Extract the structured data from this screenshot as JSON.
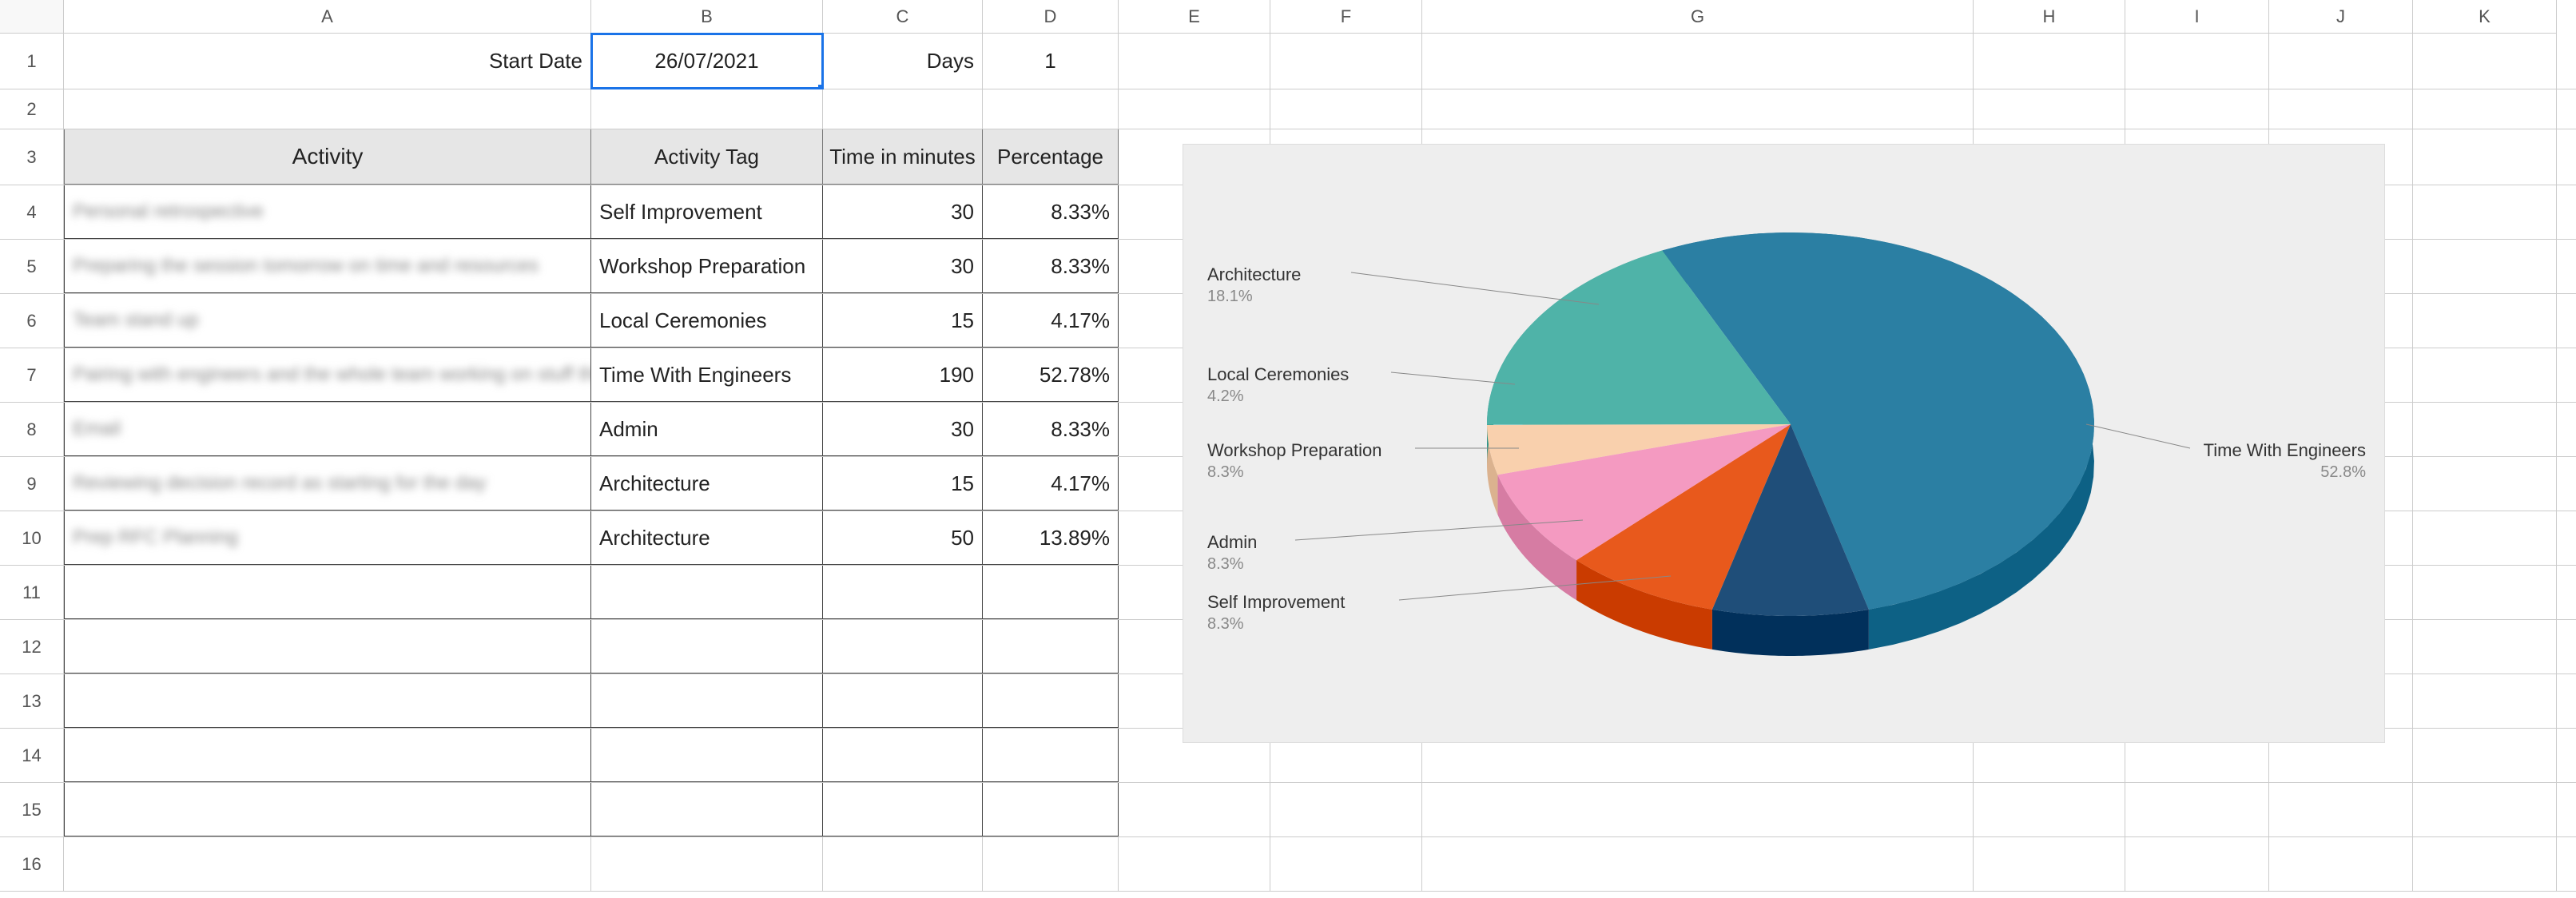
{
  "columns": [
    "A",
    "B",
    "C",
    "D",
    "E",
    "F",
    "G",
    "H",
    "I",
    "J",
    "K"
  ],
  "row_numbers": [
    1,
    2,
    3,
    4,
    5,
    6,
    7,
    8,
    9,
    10,
    11,
    12,
    13,
    14,
    15,
    16
  ],
  "meta_row": {
    "a_label": "Start Date",
    "b_value": "26/07/2021",
    "c_label": "Days",
    "d_value": "1"
  },
  "headers": {
    "activity": "Activity",
    "tag": "Activity Tag",
    "time": "Time in minutes",
    "pct": "Percentage"
  },
  "rows": [
    {
      "activity": "Personal retrospective",
      "tag": "Self Improvement",
      "time": "30",
      "pct": "8.33%"
    },
    {
      "activity": "Preparing the session tomorrow on time and resources",
      "tag": "Workshop Preparation",
      "time": "30",
      "pct": "8.33%"
    },
    {
      "activity": "Team stand up",
      "tag": "Local Ceremonies",
      "time": "15",
      "pct": "4.17%"
    },
    {
      "activity": "Pairing with engineers and the whole team working on stuff they need help on",
      "tag": "Time With Engineers",
      "time": "190",
      "pct": "52.78%"
    },
    {
      "activity": "Email",
      "tag": "Admin",
      "time": "30",
      "pct": "8.33%"
    },
    {
      "activity": "Reviewing decision record as starting for the day",
      "tag": "Architecture",
      "time": "15",
      "pct": "4.17%"
    },
    {
      "activity": "Prep RFC Planning",
      "tag": "Architecture",
      "time": "50",
      "pct": "13.89%"
    }
  ],
  "chart_data": {
    "type": "pie",
    "title": "",
    "slices": [
      {
        "name": "Time With Engineers",
        "value": 190,
        "pct": 52.8,
        "label_pct": "52.8%",
        "color": "#2b7fa3"
      },
      {
        "name": "Architecture",
        "value": 65,
        "pct": 18.1,
        "label_pct": "18.1%",
        "color": "#4fb3a8"
      },
      {
        "name": "Local Ceremonies",
        "value": 15,
        "pct": 4.2,
        "label_pct": "4.2%",
        "color": "#f9d0ad"
      },
      {
        "name": "Workshop Preparation",
        "value": 30,
        "pct": 8.3,
        "label_pct": "8.3%",
        "color": "#f49ac1"
      },
      {
        "name": "Admin",
        "value": 30,
        "pct": 8.3,
        "label_pct": "8.3%",
        "color": "#e8591c"
      },
      {
        "name": "Self Improvement",
        "value": 30,
        "pct": 8.3,
        "label_pct": "8.3%",
        "color": "#1f4e79"
      }
    ]
  }
}
